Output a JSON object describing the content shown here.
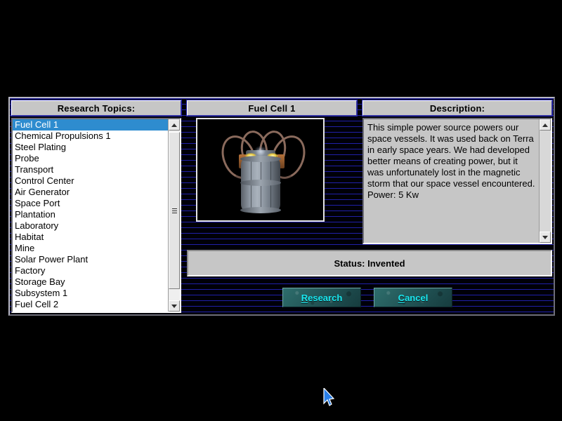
{
  "window": {
    "background_color": "#000018",
    "scanline_color": "#2020a8"
  },
  "topics_panel": {
    "header": "Research Topics:",
    "selected_index": 0,
    "items": [
      "Fuel Cell 1",
      "Chemical Propulsions 1",
      "Steel Plating",
      "Probe",
      "Transport",
      "Control Center",
      "Air Generator",
      "Space Port",
      "Plantation",
      "Laboratory",
      "Habitat",
      "Mine",
      "Solar Power Plant",
      "Factory",
      "Storage Bay",
      "Subsystem 1",
      "Fuel Cell 2"
    ],
    "scrollbar": {
      "up_icon": "triangle-up-icon",
      "down_icon": "triangle-down-icon",
      "thumb_icon": "grip-icon"
    }
  },
  "picture_panel": {
    "header": "Fuel Cell 1",
    "image_alt": "fuel-cell-render"
  },
  "description_panel": {
    "header": "Description:",
    "text": "This simple power source powers our space vessels.  It was used back on Terra in early space years. We had developed better means of creating power, but it was unfortunately lost in the magnetic storm that our space vessel encountered.  Power: 5 Kw",
    "scrollbar": {
      "up_icon": "triangle-up-icon",
      "down_icon": "triangle-down-icon"
    }
  },
  "status": {
    "text": "Status: Invented"
  },
  "buttons": {
    "research": {
      "accel": "R",
      "rest": "esearch"
    },
    "cancel": {
      "accel": "C",
      "rest": "ancel"
    },
    "text_color": "#1ae8f0"
  },
  "cursor": {
    "icon": "mouse-pointer-icon"
  }
}
